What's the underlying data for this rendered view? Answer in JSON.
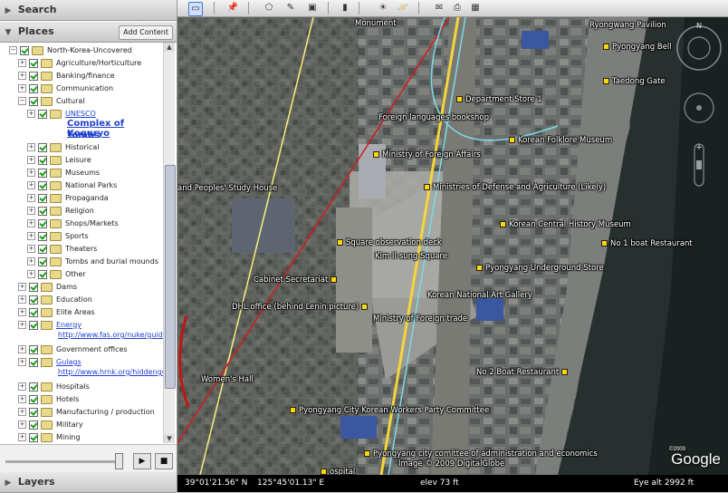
{
  "search_panel": {
    "title": "Search"
  },
  "places_panel": {
    "title": "Places",
    "add_content_label": "Add Content"
  },
  "layers_panel": {
    "title": "Layers"
  },
  "tree": {
    "root": "North-Korea-Uncovered",
    "items": [
      {
        "label": "Agriculture/Horticulture"
      },
      {
        "label": "Banking/finance"
      },
      {
        "label": "Communication"
      },
      {
        "label": "Cultural"
      },
      {
        "label": "UNESCO",
        "balloon_title": "Complex of Koguryo",
        "balloon_subtitle": "Tombs"
      },
      {
        "label": "Historical"
      },
      {
        "label": "Leisure"
      },
      {
        "label": "Museums"
      },
      {
        "label": "National Parks"
      },
      {
        "label": "Propaganda"
      },
      {
        "label": "Religion"
      },
      {
        "label": "Shops/Markets"
      },
      {
        "label": "Sports"
      },
      {
        "label": "Theaters"
      },
      {
        "label": "Tombs and burial mounds"
      },
      {
        "label": "Other"
      },
      {
        "label": "Dams"
      },
      {
        "label": "Education"
      },
      {
        "label": "Elite Areas"
      },
      {
        "label": "Energy",
        "url": "http://www.fas.org/nuke/guide"
      },
      {
        "label": "Government offices"
      },
      {
        "label": "Gulags",
        "url": "http://www.hrnk.org/hiddengu"
      },
      {
        "label": "Hospitals"
      },
      {
        "label": "Hotels"
      },
      {
        "label": "Manufacturing / production"
      },
      {
        "label": "Military"
      },
      {
        "label": "Mining"
      }
    ]
  },
  "controls": {
    "play_icon": "play-icon",
    "stop_icon": "stop-icon"
  },
  "map_labels": [
    "Monument",
    "Ryongwang Pavilion",
    "Pyongyang Bell",
    "Taedong Gate",
    "Department Store 1",
    "Foreign languages bookshop",
    "Korean Folklore Museum",
    "Ministry of Foreign Affairs",
    "Ministries of Defense and Agriculture (Likely)",
    "and Peoples' Study House",
    "Korean Central History Museum",
    "No 1 boat Restaurant",
    "Square observation deck",
    "Kim Il-sung Square",
    "Pyongyang Underground Store",
    "Cabinet Secretariat",
    "Korean National Art Gallery",
    "DHL office (behind Lenin picture)",
    "Ministry of Foreign trade",
    "No 2 Boat Restaurant",
    "Women's Hall",
    "Pyongyang City Korean Workers Party Committee",
    "Pyongyang city comittee of administration and economics",
    "Image © 2009 DigitalGlobe",
    "ospital"
  ],
  "logo": "Google",
  "logo_copyright": "©2009",
  "status": {
    "coords": "39°01'21.56\" N",
    "coords_lon": "125°45'01.13\" E",
    "elev": "elev    73 ft",
    "eye_alt": "Eye alt    2992 ft"
  },
  "colors": {
    "panel_header": "#d0d0d0",
    "link": "#1f3fd0",
    "map_label": "#ffffff",
    "pin": "#ffd800"
  }
}
